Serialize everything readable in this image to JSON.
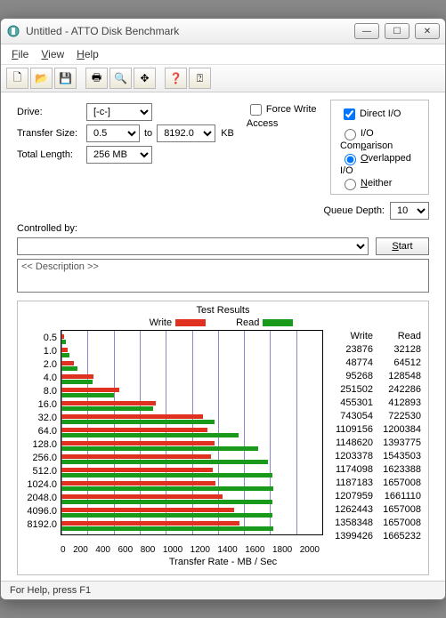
{
  "window": {
    "title": "Untitled - ATTO Disk Benchmark"
  },
  "menus": {
    "file": "File",
    "view": "View",
    "help": "Help"
  },
  "labels": {
    "drive": "Drive:",
    "transfer_size": "Transfer Size:",
    "to": "to",
    "kb": "KB",
    "total_length": "Total Length:",
    "force_write": "Force Write Access",
    "direct_io": "Direct I/O",
    "io_comparison": "I/O Comparison",
    "overlapped": "Overlapped I/O",
    "neither": "Neither",
    "queue_depth": "Queue Depth:",
    "controlled_by": "Controlled by:",
    "start": "Start",
    "description": "<< Description >>",
    "test_results": "Test Results",
    "write": "Write",
    "read": "Read",
    "transfer_rate": "Transfer Rate - MB / Sec"
  },
  "values": {
    "drive": "[-c-]",
    "ts_from": "0.5",
    "ts_to": "8192.0",
    "total_length": "256 MB",
    "queue_depth": "10",
    "direct_io": true,
    "force_write": false,
    "io_mode": "overlapped",
    "controlled_by": ""
  },
  "status": "For Help, press F1",
  "chart_data": {
    "type": "bar",
    "xlabel": "Transfer Rate - MB / Sec",
    "xlim": [
      0,
      2000
    ],
    "xticks": [
      0,
      200,
      400,
      600,
      800,
      1000,
      1200,
      1400,
      1600,
      1800,
      2000
    ],
    "series_names": [
      "Write",
      "Read"
    ],
    "categories": [
      "0.5",
      "1.0",
      "2.0",
      "4.0",
      "8.0",
      "16.0",
      "32.0",
      "64.0",
      "128.0",
      "256.0",
      "512.0",
      "1024.0",
      "2048.0",
      "4096.0",
      "8192.0"
    ],
    "write_raw": [
      23876,
      48774,
      95268,
      251502,
      455301,
      743054,
      1109156,
      1148620,
      1203378,
      1174098,
      1187183,
      1207959,
      1262443,
      1358348,
      1399426
    ],
    "read_raw": [
      32128,
      64512,
      128548,
      242286,
      412893,
      722530,
      1200384,
      1393775,
      1543503,
      1623388,
      1657008,
      1661110,
      1657008,
      1657008,
      1665232
    ],
    "display_scale": "KB/s shown in numeric columns; bars approximate MB/s"
  }
}
